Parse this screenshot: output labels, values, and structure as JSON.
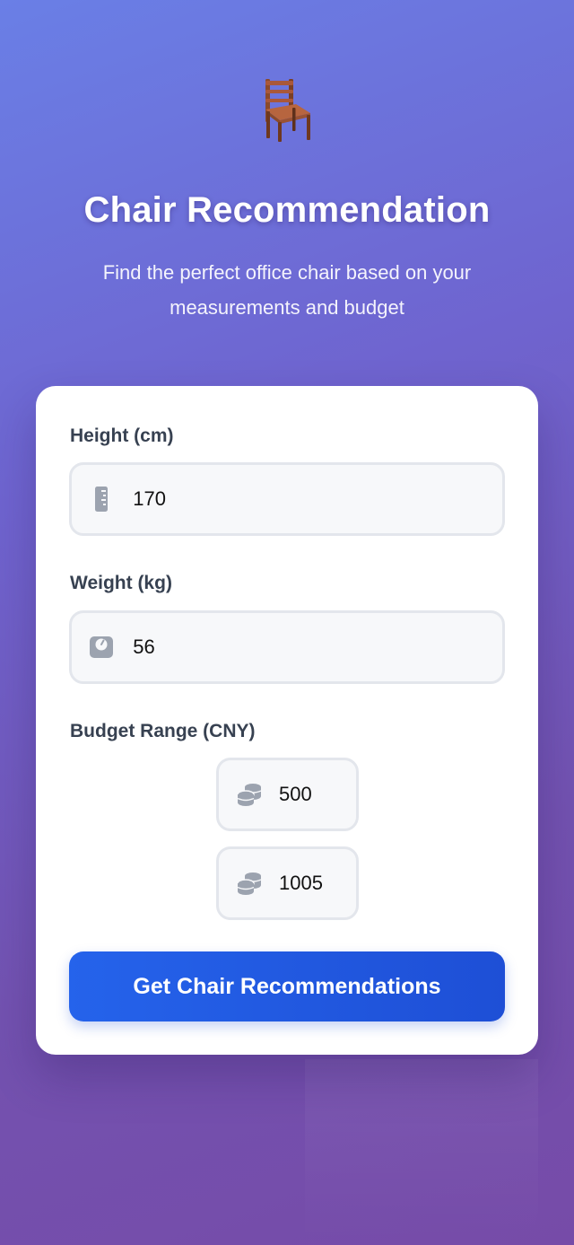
{
  "header": {
    "icon": "chair-icon",
    "title": "Chair Recommendation",
    "subtitle": "Find the perfect office chair based on your measurements and budget"
  },
  "form": {
    "height": {
      "label": "Height (cm)",
      "icon": "ruler-icon",
      "value": "170"
    },
    "weight": {
      "label": "Weight (kg)",
      "icon": "scale-icon",
      "value": "56"
    },
    "budget": {
      "label": "Budget Range (CNY)",
      "icon": "coins-icon",
      "min_value": "500",
      "max_value": "1005"
    },
    "submit_label": "Get Chair Recommendations"
  },
  "colors": {
    "primary_button": "#2563eb",
    "background_start": "#6a7fe6",
    "background_end": "#764ba8",
    "card": "#ffffff",
    "label_text": "#374151",
    "icon_gray": "#9ca3af"
  }
}
